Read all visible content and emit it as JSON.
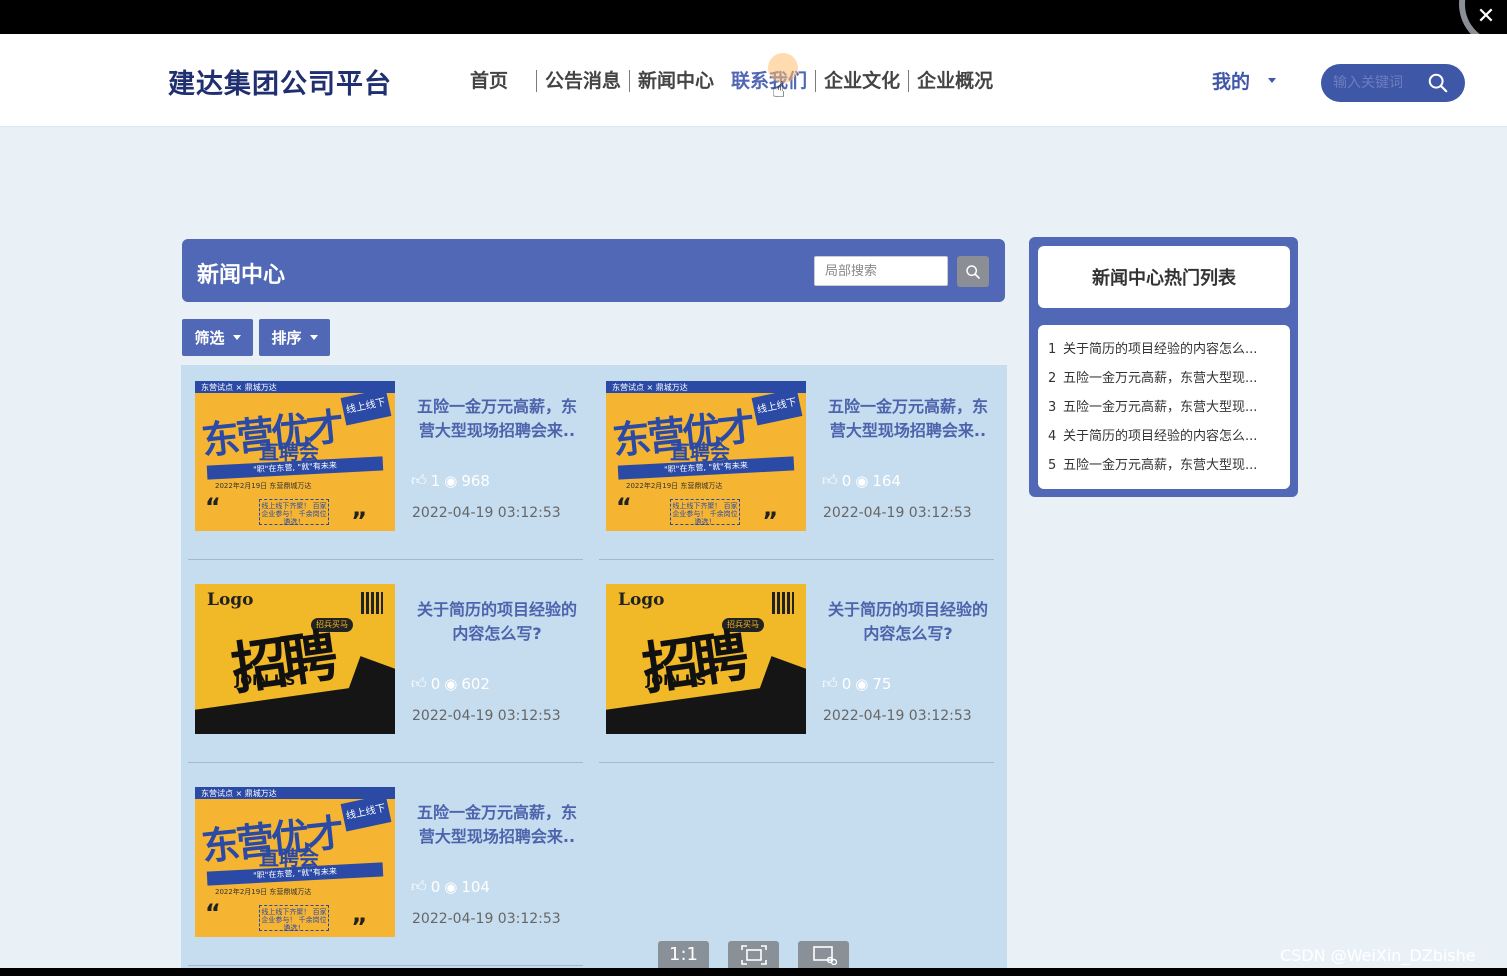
{
  "window": {
    "close_label": "✕"
  },
  "header": {
    "brand": "建达集团公司平台",
    "nav": [
      {
        "label": "首页"
      },
      {
        "label": "公告消息"
      },
      {
        "label": "新闻中心"
      },
      {
        "label": "联系我们"
      },
      {
        "label": "企业文化"
      },
      {
        "label": "企业概况"
      }
    ],
    "mine": "我的",
    "search_placeholder": "输入关键词"
  },
  "panel": {
    "title": "新闻中心",
    "search_placeholder": "局部搜索",
    "filter_label": "筛选",
    "sort_label": "排序"
  },
  "cards": [
    {
      "title": "五险一金万元高薪，东营大型现场招聘会来..",
      "likes": "1",
      "views": "968",
      "date": "2022-04-19 03:12:53",
      "poster": "a"
    },
    {
      "title": "五险一金万元高薪，东营大型现场招聘会来..",
      "likes": "0",
      "views": "164",
      "date": "2022-04-19 03:12:53",
      "poster": "a"
    },
    {
      "title": "关于简历的项目经验的内容怎么写?",
      "likes": "0",
      "views": "602",
      "date": "2022-04-19 03:12:53",
      "poster": "b"
    },
    {
      "title": "关于简历的项目经验的内容怎么写?",
      "likes": "0",
      "views": "75",
      "date": "2022-04-19 03:12:53",
      "poster": "b"
    },
    {
      "title": "五险一金万元高薪，东营大型现场招聘会来..",
      "likes": "0",
      "views": "104",
      "date": "2022-04-19 03:12:53",
      "poster": "a"
    }
  ],
  "poster_a": {
    "band": "东营试点 × 鼎城万达",
    "big": "东营优才",
    "sub": "直聘会",
    "tag": "线上线下",
    "ribbon": "\"职\"在东营, \"就\"有未来",
    "info": "2022年2月19日   东营鼎城万达",
    "box": "线上线下齐聚！ 百家企业参与！ 千余岗位遴选！"
  },
  "poster_b": {
    "logo": "Logo",
    "pill": "招兵买马",
    "brush": "招聘",
    "join": "JOIN US"
  },
  "sidebar": {
    "title": "新闻中心热门列表",
    "items": [
      {
        "num": "1",
        "text": "关于简历的项目经验的内容怎么..."
      },
      {
        "num": "2",
        "text": "五险一金万元高薪，东营大型现..."
      },
      {
        "num": "3",
        "text": "五险一金万元高薪，东营大型现..."
      },
      {
        "num": "4",
        "text": "关于简历的项目经验的内容怎么..."
      },
      {
        "num": "5",
        "text": "五险一金万元高薪，东营大型现..."
      }
    ]
  },
  "viewer_tools": [
    {
      "label": "1:1",
      "icon": "actual-size-icon"
    },
    {
      "label": "",
      "icon": "fit-screen-icon"
    },
    {
      "label": "",
      "icon": "screenshot-icon"
    }
  ],
  "watermark": "CSDN @WeiXin_DZbishe",
  "colors": {
    "brand": "#1f2f6f",
    "primary": "#5068b6",
    "active_nav": "#5067b5",
    "list_bg": "#c6ddef"
  }
}
